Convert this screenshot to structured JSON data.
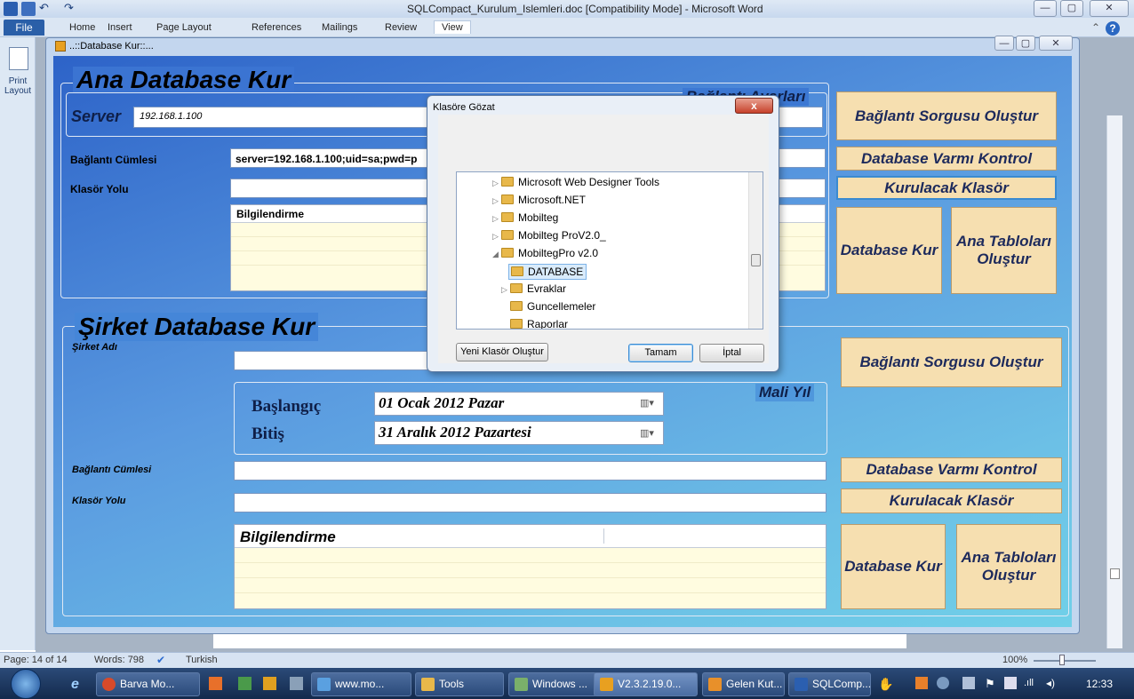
{
  "word": {
    "title": "SQLCompact_Kurulum_Islemleri.doc [Compatibility Mode] - Microsoft Word",
    "tabs": [
      "File",
      "Home",
      "Insert",
      "Page Layout",
      "References",
      "Mailings",
      "Review",
      "View"
    ],
    "left_button": "Print Layout",
    "status": {
      "page": "Page: 14 of 14",
      "words": "Words: 798",
      "language": "Turkish",
      "zoom": "100%"
    }
  },
  "app": {
    "window_title": "..::Database Kur::...",
    "ana": {
      "group_title": "Ana Database Kur",
      "server_label": "Server",
      "server_value": "192.168.1.100",
      "ayarlar_label": "Bağlantı Ayarları",
      "baglanti_label": "Bağlantı Cümlesi",
      "baglanti_value": "server=192.168.1.100;uid=sa;pwd=p",
      "klasor_label": "Klasör Yolu",
      "grid_header": "Bilgilendirme",
      "btn_sorgu": "Bağlantı Sorgusu Oluştur",
      "btn_varmi": "Database Varmı Kontrol",
      "btn_klasor": "Kurulacak Klasör",
      "btn_kur": "Database Kur",
      "btn_tablo": "Ana Tabloları Oluştur"
    },
    "sirket": {
      "group_title": "Şirket Database Kur",
      "sirket_adi_label": "Şirket Adı",
      "mali_yil_label": "Mali Yıl",
      "baslangic_label": "Başlangıç",
      "baslangic_value": "01   Ocak   2012   Pazar",
      "bitis_label": "Bitiş",
      "bitis_value": "31  Aralık  2012  Pazartesi",
      "baglanti_label": "Bağlantı Cümlesi",
      "klasor_label": "Klasör Yolu",
      "grid_header": "Bilgilendirme",
      "btn_sorgu": "Bağlantı Sorgusu Oluştur",
      "btn_varmi": "Database Varmı Kontrol",
      "btn_klasor": "Kurulacak Klasör",
      "btn_kur": "Database Kur",
      "btn_tablo": "Ana Tabloları Oluştur"
    }
  },
  "dialog": {
    "title": "Klasöre Gözat",
    "close": "x",
    "tree": [
      {
        "label": "Microsoft Web Designer Tools",
        "arrow": "▷"
      },
      {
        "label": "Microsoft.NET",
        "arrow": "▷"
      },
      {
        "label": "Mobilteg",
        "arrow": "▷"
      },
      {
        "label": "Mobilteg ProV2.0_",
        "arrow": "▷"
      },
      {
        "label": "MobiltegPro v2.0",
        "arrow": "◢"
      },
      {
        "label": "DATABASE",
        "arrow": ""
      },
      {
        "label": "Evraklar",
        "arrow": "▷"
      },
      {
        "label": "Guncellemeler",
        "arrow": ""
      },
      {
        "label": "Raporlar",
        "arrow": ""
      }
    ],
    "btn_new": "Yeni Klasör Oluştur",
    "btn_ok": "Tamam",
    "btn_cancel": "İptal"
  },
  "taskbar": {
    "items": [
      "Barva Mo...",
      "www.mo...",
      "Tools",
      "Windows ...",
      "V2.3.2.19.0...",
      "Gelen Kut...",
      "SQLComp..."
    ],
    "clock": "12:33"
  }
}
